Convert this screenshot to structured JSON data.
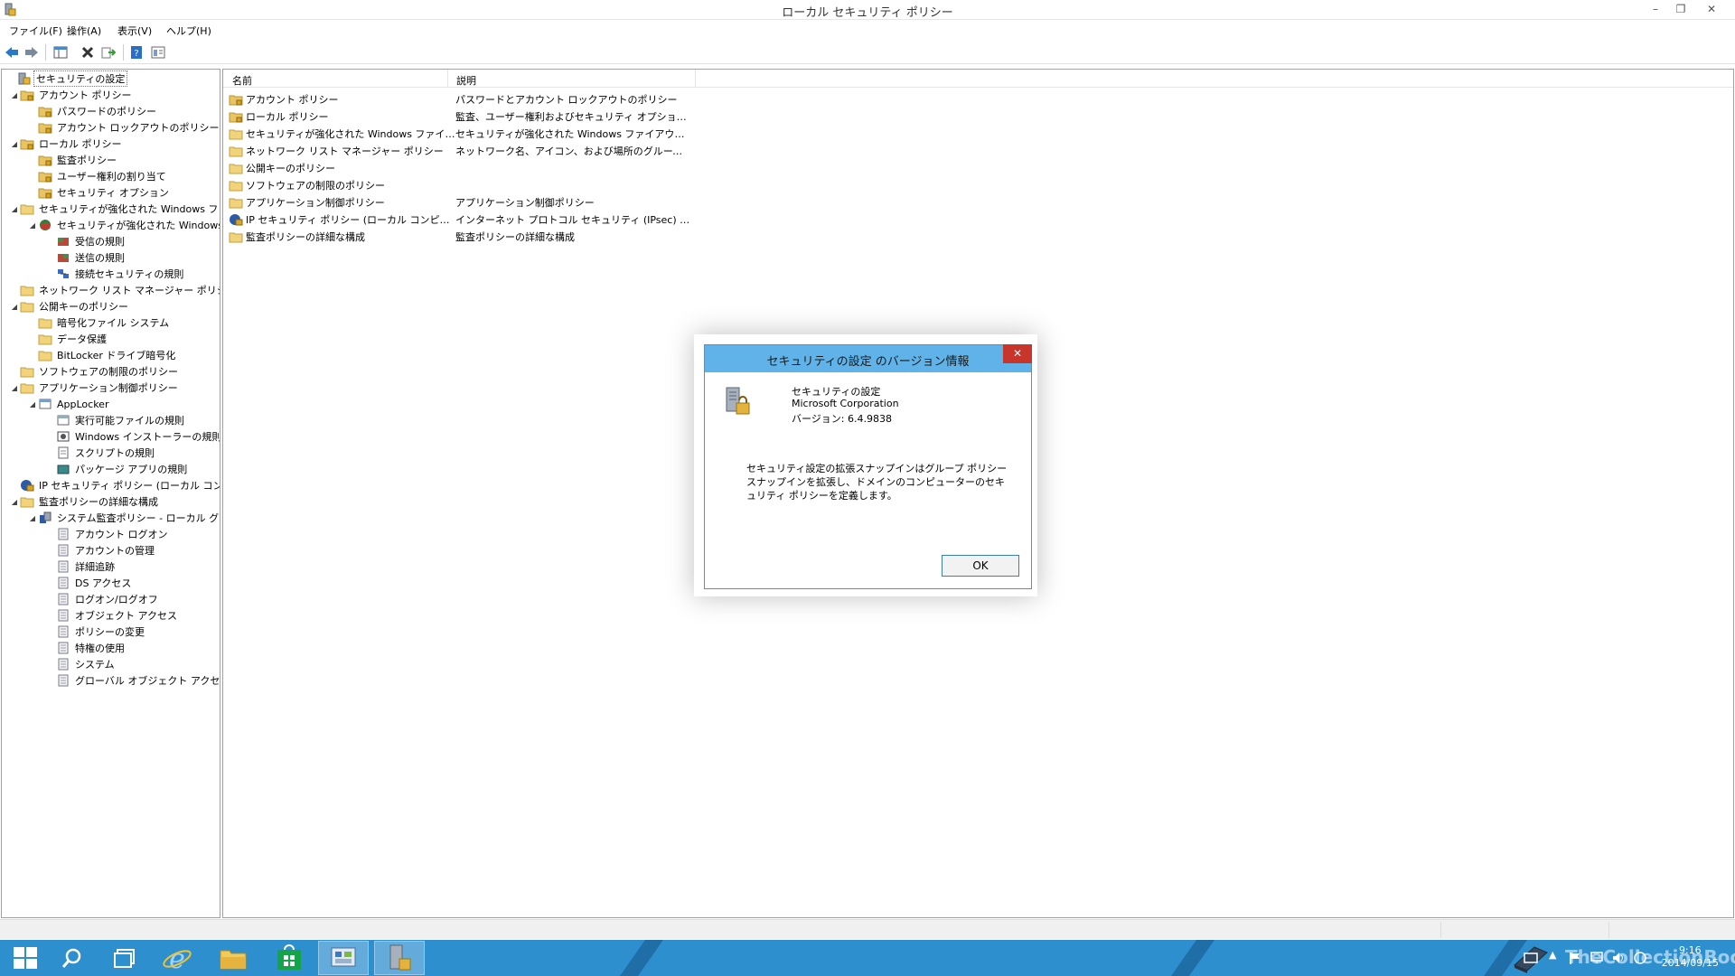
{
  "window": {
    "title": "ローカル セキュリティ ポリシー",
    "minimize": "–",
    "restore": "❐",
    "close": "✕"
  },
  "menu": {
    "file": "ファイル(F)",
    "action": "操作(A)",
    "view": "表示(V)",
    "help": "ヘルプ(H)"
  },
  "tree": {
    "items": [
      {
        "label": "セキュリティの設定",
        "icon": "security-settings-icon"
      },
      {
        "label": "アカウント ポリシー",
        "icon": "folder-lock-icon"
      },
      {
        "label": "パスワードのポリシー",
        "icon": "folder-lock-icon"
      },
      {
        "label": "アカウント ロックアウトのポリシー",
        "icon": "folder-lock-icon"
      },
      {
        "label": "ローカル ポリシー",
        "icon": "folder-lock-icon"
      },
      {
        "label": "監査ポリシー",
        "icon": "folder-lock-icon"
      },
      {
        "label": "ユーザー権利の割り当て",
        "icon": "folder-lock-icon"
      },
      {
        "label": "セキュリティ オプション",
        "icon": "folder-lock-icon"
      },
      {
        "label": "セキュリティが強化された Windows ファイアウォール",
        "icon": "folder-icon"
      },
      {
        "label": "セキュリティが強化された Windows ファイアウォール - ローカル グループ ポリシー オブジェクト",
        "icon": "firewall-icon"
      },
      {
        "label": "受信の規則",
        "icon": "inbound-rules-icon"
      },
      {
        "label": "送信の規則",
        "icon": "outbound-rules-icon"
      },
      {
        "label": "接続セキュリティの規則",
        "icon": "connection-rules-icon"
      },
      {
        "label": "ネットワーク リスト マネージャー ポリシー",
        "icon": "folder-icon"
      },
      {
        "label": "公開キーのポリシー",
        "icon": "folder-icon"
      },
      {
        "label": "暗号化ファイル システム",
        "icon": "folder-icon"
      },
      {
        "label": "データ保護",
        "icon": "folder-icon"
      },
      {
        "label": "BitLocker ドライブ暗号化",
        "icon": "folder-icon"
      },
      {
        "label": "ソフトウェアの制限のポリシー",
        "icon": "folder-icon"
      },
      {
        "label": "アプリケーション制御ポリシー",
        "icon": "folder-icon"
      },
      {
        "label": "AppLocker",
        "icon": "applocker-icon"
      },
      {
        "label": "実行可能ファイルの規則",
        "icon": "rules-icon"
      },
      {
        "label": "Windows インストーラーの規則",
        "icon": "installer-icon"
      },
      {
        "label": "スクリプトの規則",
        "icon": "script-icon"
      },
      {
        "label": "パッケージ アプリの規則",
        "icon": "package-icon"
      },
      {
        "label": "IP セキュリティ ポリシー (ローカル コンピューター)",
        "icon": "ip-security-icon"
      },
      {
        "label": "監査ポリシーの詳細な構成",
        "icon": "folder-icon"
      },
      {
        "label": "システム監査ポリシー - ローカル グループ ポリシー オブジェクト",
        "icon": "audit-icon"
      },
      {
        "label": "アカウント ログオン",
        "icon": "policy-doc-icon"
      },
      {
        "label": "アカウントの管理",
        "icon": "policy-doc-icon"
      },
      {
        "label": "詳細追跡",
        "icon": "policy-doc-icon"
      },
      {
        "label": "DS アクセス",
        "icon": "policy-doc-icon"
      },
      {
        "label": "ログオン/ログオフ",
        "icon": "policy-doc-icon"
      },
      {
        "label": "オブジェクト アクセス",
        "icon": "policy-doc-icon"
      },
      {
        "label": "ポリシーの変更",
        "icon": "policy-doc-icon"
      },
      {
        "label": "特権の使用",
        "icon": "policy-doc-icon"
      },
      {
        "label": "システム",
        "icon": "policy-doc-icon"
      },
      {
        "label": "グローバル オブジェクト アクセスの監査",
        "icon": "policy-doc-icon"
      }
    ]
  },
  "list": {
    "col_name": "名前",
    "col_desc": "説明",
    "rows": [
      {
        "name": "アカウント ポリシー",
        "desc": "パスワードとアカウント ロックアウトのポリシー",
        "icon": "folder-lock-icon"
      },
      {
        "name": "ローカル ポリシー",
        "desc": "監査、ユーザー権利およびセキュリティ オプションのポリシー",
        "icon": "folder-lock-icon"
      },
      {
        "name": "セキュリティが強化された Windows ファイアウォール",
        "desc": "セキュリティが強化された Windows ファイアウォール",
        "icon": "folder-icon"
      },
      {
        "name": "ネットワーク リスト マネージャー ポリシー",
        "desc": "ネットワーク名、アイコン、および場所のグループ ポリシー",
        "icon": "folder-icon"
      },
      {
        "name": "公開キーのポリシー",
        "desc": "",
        "icon": "folder-icon"
      },
      {
        "name": "ソフトウェアの制限のポリシー",
        "desc": "",
        "icon": "folder-icon"
      },
      {
        "name": "アプリケーション制御ポリシー",
        "desc": "アプリケーション制御ポリシー",
        "icon": "folder-icon"
      },
      {
        "name": "IP セキュリティ ポリシー (ローカル コンピューター)",
        "desc": "インターネット プロトコル セキュリティ (IPsec) 管理。ほかのコンピューターとのセキュリティで保護された通信",
        "icon": "ip-security-icon"
      },
      {
        "name": "監査ポリシーの詳細な構成",
        "desc": "監査ポリシーの詳細な構成",
        "icon": "folder-icon"
      }
    ]
  },
  "dialog": {
    "title": "セキュリティの設定 のバージョン情報",
    "close": "✕",
    "product": "セキュリティの設定",
    "company": "Microsoft Corporation",
    "version": "バージョン: 6.4.9838",
    "description": "セキュリティ設定の拡張スナップインはグループ ポリシー スナップインを拡張し、ドメインのコンピューターのセキュリティ ポリシーを定義します。",
    "ok": "OK"
  },
  "taskbar": {
    "clock_time": "9:16",
    "clock_date": "2014/09/15",
    "watermark": "TheCollectionBook"
  },
  "colors": {
    "taskbar": "#2e8fcf",
    "dialog_title": "#5fb3e8",
    "close_red": "#c7352b"
  }
}
